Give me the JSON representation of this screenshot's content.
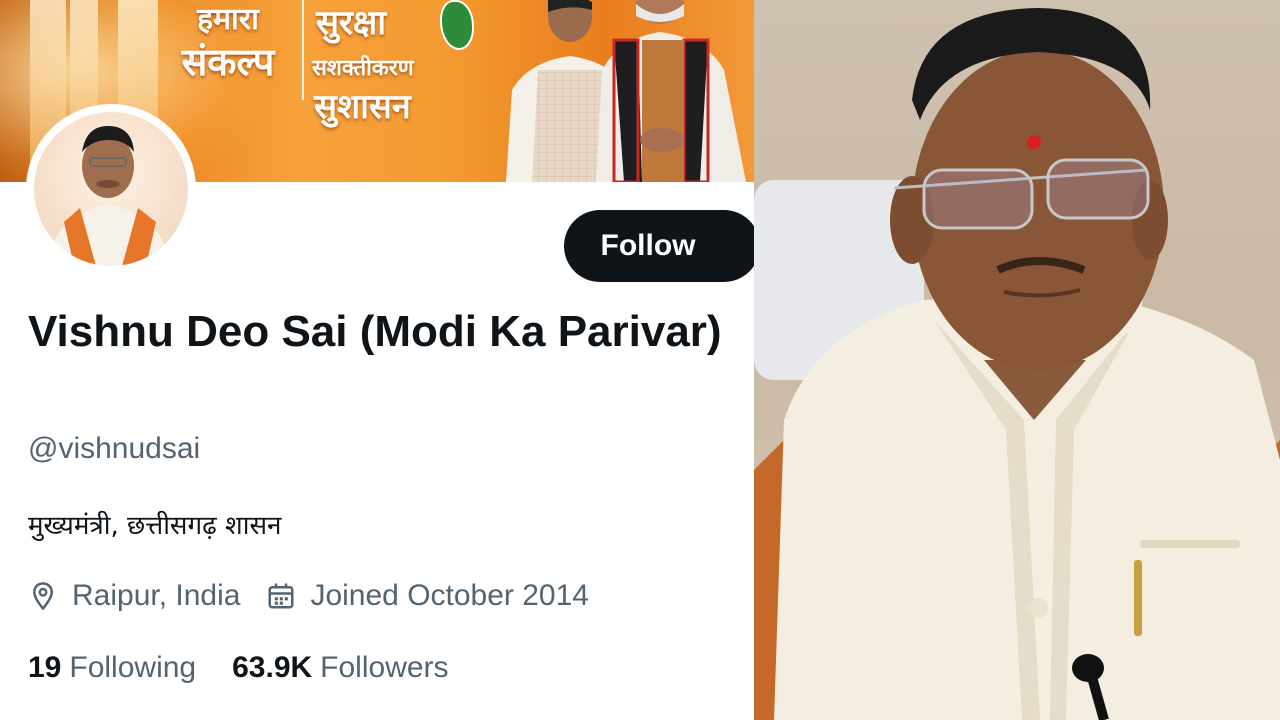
{
  "profile": {
    "display_name": "Vishnu Deo Sai (Modi Ka Parivar)",
    "handle": "@vishnudsai",
    "bio": "मुख्यमंत्री, छत्तीसगढ़ शासन",
    "location": "Raipur, India",
    "joined": "Joined October 2014",
    "following_count": "19",
    "following_label": "Following",
    "followers_count": "63.9K",
    "followers_label": "Followers",
    "follow_button": "Follow"
  },
  "banner": {
    "line1": "हमारा",
    "line2": "संकल्प",
    "line3": "सुरक्षा",
    "line4": "सशक्तीकरण",
    "line5": "सुशासन"
  },
  "icons": {
    "location": "location-pin-icon",
    "joined": "calendar-icon"
  },
  "colors": {
    "primary_text": "#0f1419",
    "secondary_text": "#536471",
    "button_bg": "#0f1419",
    "banner_orange": "#f39a30"
  }
}
